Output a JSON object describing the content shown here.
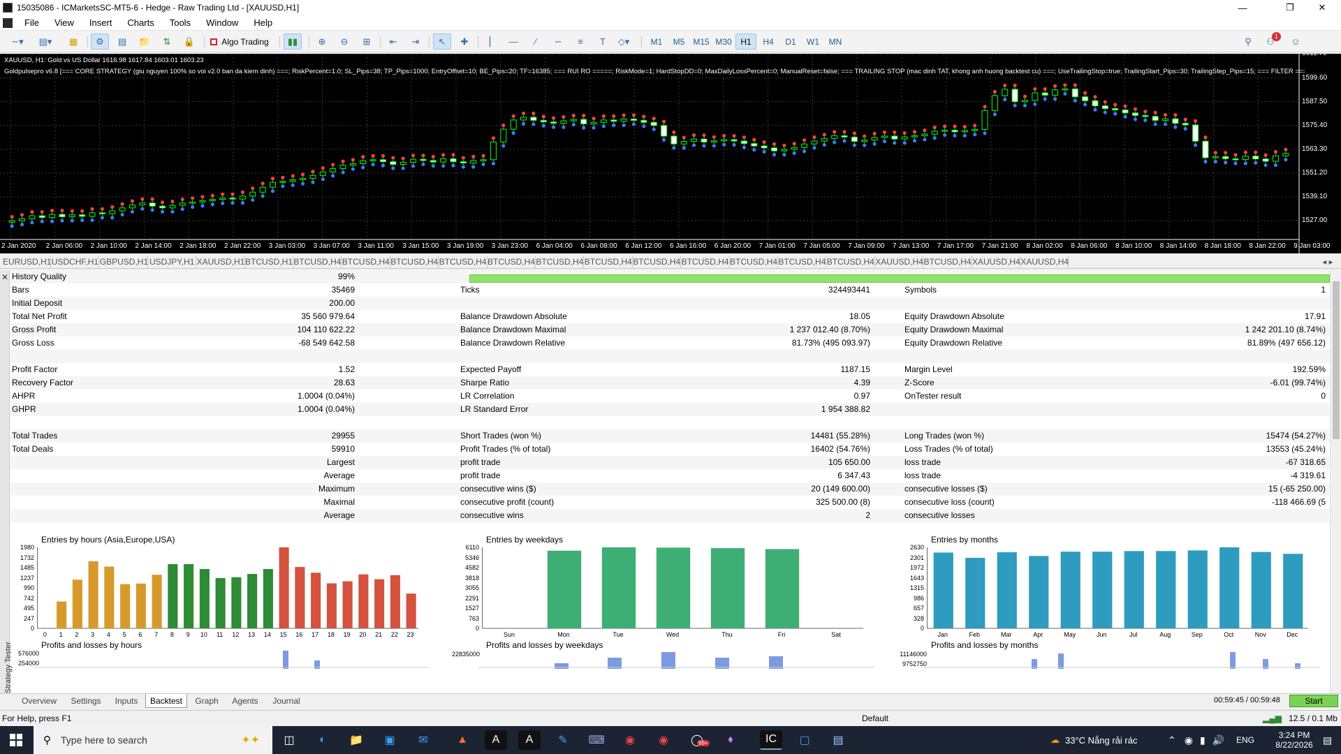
{
  "window": {
    "title": "15035086 - ICMarketsSC-MT5-6 - Hedge - Raw Trading Ltd - [XAUUSD,H1]"
  },
  "menu": [
    "File",
    "View",
    "Insert",
    "Charts",
    "Tools",
    "Window",
    "Help"
  ],
  "toolbar": {
    "algo_label": "Algo Trading",
    "timeframes": [
      "M1",
      "M5",
      "M15",
      "M30",
      "H1",
      "H4",
      "D1",
      "W1",
      "MN"
    ],
    "active_tf": "H1",
    "notif_count": "1"
  },
  "chart": {
    "symbol_line": "XAUUSD, H1:  Gold vs US Dollar  1616.98 1617.84 1603.01 1603.23",
    "ea_line": "Goldpulsepro v6.8 [=== CORE STRATEGY (giu nguyen 100% so voi v2.0 ban da kiem dinh) ===; RiskPercent=1.0; SL_Pips=38; TP_Pips=1000; EntryOffset=10; BE_Pips=20; TF=16385; === RUI RO =====; RiskMode=1; HardStopDD=0; MaxDailyLossPercent=0; ManualReset=false; === TRAILING STOP (mac dinh TAT, khong anh huong backtest cu) ===; UseTrailingStop=true; TrailingStart_Pips=30; TrailingStep_Pips=15; === FILTER ===",
    "price_labels": [
      "1611.70",
      "1599.60",
      "1587.50",
      "1575.40",
      "1563.30",
      "1551.20",
      "1539.10",
      "1527.00"
    ],
    "time_labels": [
      "2 Jan 2020",
      "2 Jan 06:00",
      "2 Jan 10:00",
      "2 Jan 14:00",
      "2 Jan 18:00",
      "2 Jan 22:00",
      "3 Jan 03:00",
      "3 Jan 07:00",
      "3 Jan 11:00",
      "3 Jan 15:00",
      "3 Jan 19:00",
      "3 Jan 23:00",
      "6 Jan 04:00",
      "6 Jan 08:00",
      "6 Jan 12:00",
      "6 Jan 16:00",
      "6 Jan 20:00",
      "7 Jan 01:00",
      "7 Jan 05:00",
      "7 Jan 09:00",
      "7 Jan 13:00",
      "7 Jan 17:00",
      "7 Jan 21:00",
      "8 Jan 02:00",
      "8 Jan 06:00",
      "8 Jan 10:00",
      "8 Jan 14:00",
      "8 Jan 18:00",
      "8 Jan 22:00",
      "9 Jan 03:00"
    ],
    "closes": [
      1527.0,
      1528.0,
      1529.5,
      1528.6,
      1530.2,
      1529.0,
      1530.0,
      1529.2,
      1531.0,
      1530.5,
      1532.0,
      1533.5,
      1535.0,
      1536.0,
      1534.4,
      1533.5,
      1534.8,
      1535.9,
      1536.5,
      1537.2,
      1537.8,
      1538.5,
      1538.0,
      1539.5,
      1541.5,
      1544.0,
      1546.5,
      1547.0,
      1547.8,
      1548.5,
      1550.0,
      1551.8,
      1553.5,
      1555.2,
      1556.0,
      1557.5,
      1558.0,
      1557.0,
      1555.6,
      1556.7,
      1558.2,
      1557.6,
      1556.8,
      1558.5,
      1557.0,
      1556.3,
      1557.6,
      1558.0,
      1567.0,
      1573.5,
      1578.2,
      1579.6,
      1578.0,
      1577.2,
      1576.5,
      1577.8,
      1578.5,
      1576.2,
      1577.0,
      1578.2,
      1577.5,
      1578.7,
      1578.0,
      1577.0,
      1575.4,
      1570.0,
      1566.0,
      1567.3,
      1568.5,
      1567.0,
      1567.6,
      1568.2,
      1567.5,
      1566.2,
      1565.0,
      1564.0,
      1562.5,
      1563.3,
      1564.2,
      1566.0,
      1567.5,
      1568.8,
      1570.2,
      1569.5,
      1567.3,
      1568.0,
      1569.3,
      1570.0,
      1568.5,
      1569.6,
      1570.2,
      1571.0,
      1572.5,
      1573.0,
      1572.2,
      1572.8,
      1573.4,
      1583.0,
      1590.6,
      1593.8,
      1587.5,
      1588.2,
      1592.0,
      1590.8,
      1593.5,
      1594.0,
      1590.0,
      1588.0,
      1585.4,
      1584.0,
      1583.3,
      1581.8,
      1580.5,
      1580.0,
      1578.0,
      1578.8,
      1576.5,
      1575.7,
      1567.4,
      1559.0,
      1559.6,
      1558.5,
      1558.1,
      1559.8,
      1558.4,
      1557.2,
      1560.0,
      1561.2
    ]
  },
  "symbol_tabs": [
    "EURUSD,H1",
    "USDCHF,H1",
    "GBPUSD,H1",
    "USDJPY,H1",
    "XAUUSD,H1",
    "BTCUSD,H1",
    "BTCUSD,H4",
    "BTCUSD,H4",
    "BTCUSD,H4",
    "BTCUSD,H4",
    "BTCUSD,H4",
    "BTCUSD,H4",
    "BTCUSD,H4",
    "BTCUSD,H4",
    "BTCUSD,H4",
    "BTCUSD,H4",
    "BTCUSD,H4",
    "BTCUSD,H4",
    "XAUUSD,H4",
    "BTCUSD,H4",
    "XAUUSD,H4",
    "XAUUSD,H4"
  ],
  "report": {
    "history_quality": {
      "label": "History Quality",
      "value": "99%",
      "fraction": 0.99
    },
    "rows": [
      [
        "Bars",
        "35469",
        "Ticks",
        "324493441",
        "Symbols",
        "1"
      ],
      [
        "Initial Deposit",
        "200.00",
        "",
        "",
        "",
        ""
      ],
      [
        "Total Net Profit",
        "35 560 979.64",
        "Balance Drawdown Absolute",
        "18.05",
        "Equity Drawdown Absolute",
        "17.91"
      ],
      [
        "Gross Profit",
        "104 110 622.22",
        "Balance Drawdown Maximal",
        "1 237 012.40 (8.70%)",
        "Equity Drawdown Maximal",
        "1 242 201.10 (8.74%)"
      ],
      [
        "Gross Loss",
        "-68 549 642.58",
        "Balance Drawdown Relative",
        "81.73% (495 093.97)",
        "Equity Drawdown Relative",
        "81.89% (497 656.12)"
      ],
      [
        "",
        "",
        "",
        "",
        "",
        ""
      ],
      [
        "Profit Factor",
        "1.52",
        "Expected Payoff",
        "1187.15",
        "Margin Level",
        "192.59%"
      ],
      [
        "Recovery Factor",
        "28.63",
        "Sharpe Ratio",
        "4.39",
        "Z-Score",
        "-6.01 (99.74%)"
      ],
      [
        "AHPR",
        "1.0004 (0.04%)",
        "LR Correlation",
        "0.97",
        "OnTester result",
        "0"
      ],
      [
        "GHPR",
        "1.0004 (0.04%)",
        "LR Standard Error",
        "1 954 388.82",
        "",
        ""
      ],
      [
        "",
        "",
        "",
        "",
        "",
        ""
      ],
      [
        "Total Trades",
        "29955",
        "Short Trades (won %)",
        "14481 (55.28%)",
        "Long Trades (won %)",
        "15474 (54.27%)"
      ],
      [
        "Total Deals",
        "59910",
        "Profit Trades (% of total)",
        "16402 (54.76%)",
        "Loss Trades (% of total)",
        "13553 (45.24%)"
      ],
      [
        "",
        "Largest",
        "profit trade",
        "105 650.00",
        "loss trade",
        "-67 318.65"
      ],
      [
        "",
        "Average",
        "profit trade",
        "6 347.43",
        "loss trade",
        "-4 319.61"
      ],
      [
        "",
        "Maximum",
        "consecutive wins ($)",
        "20 (149 600.00)",
        "consecutive losses ($)",
        "15 (-65 250.00)"
      ],
      [
        "",
        "Maximal",
        "consecutive profit (count)",
        "325 500.00 (8)",
        "consecutive loss (count)",
        "-118 466.69 (5"
      ],
      [
        "",
        "Average",
        "consecutive wins",
        "2",
        "consecutive losses",
        ""
      ]
    ]
  },
  "chart_data": [
    {
      "type": "bar",
      "title": "Entries by hours (Asia,Europe,USA)",
      "categories": [
        "0",
        "1",
        "2",
        "3",
        "4",
        "5",
        "6",
        "7",
        "8",
        "9",
        "10",
        "11",
        "12",
        "13",
        "14",
        "15",
        "16",
        "17",
        "18",
        "19",
        "20",
        "21",
        "22",
        "23"
      ],
      "values": [
        0,
        655,
        1190,
        1640,
        1510,
        1080,
        1095,
        1310,
        1570,
        1570,
        1450,
        1230,
        1250,
        1330,
        1450,
        1980,
        1500,
        1360,
        1100,
        1150,
        1320,
        1200,
        1300,
        850
      ],
      "yticks": [
        "1980",
        "1732",
        "1485",
        "1237",
        "990",
        "742",
        "495",
        "247",
        "0"
      ],
      "ylim": [
        0,
        1980
      ],
      "colors": [
        "#d79a2a",
        "#d79a2a",
        "#d79a2a",
        "#d79a2a",
        "#d79a2a",
        "#d79a2a",
        "#d79a2a",
        "#d79a2a",
        "#2e8b36",
        "#2e8b36",
        "#2e8b36",
        "#2e8b36",
        "#2e8b36",
        "#2e8b36",
        "#2e8b36",
        "#d4523f",
        "#d4523f",
        "#d4523f",
        "#d4523f",
        "#d4523f",
        "#d4523f",
        "#d4523f",
        "#d4523f",
        "#d4523f"
      ]
    },
    {
      "type": "bar",
      "title": "Entries by weekdays",
      "categories": [
        "Sun",
        "Mon",
        "Tue",
        "Wed",
        "Thu",
        "Fri",
        "Sat"
      ],
      "values": [
        0,
        5860,
        6110,
        6090,
        6050,
        5980,
        0
      ],
      "yticks": [
        "6110",
        "5346",
        "4582",
        "3818",
        "3055",
        "2291",
        "1527",
        "763",
        "0"
      ],
      "ylim": [
        0,
        6110
      ],
      "colors": [
        "#3fae74",
        "#3fae74",
        "#3fae74",
        "#3fae74",
        "#3fae74",
        "#3fae74",
        "#3fae74"
      ]
    },
    {
      "type": "bar",
      "title": "Entries by months",
      "categories": [
        "Jan",
        "Feb",
        "Mar",
        "Apr",
        "May",
        "Jun",
        "Jul",
        "Aug",
        "Sep",
        "Oct",
        "Nov",
        "Dec"
      ],
      "values": [
        2460,
        2290,
        2470,
        2350,
        2490,
        2490,
        2510,
        2510,
        2530,
        2630,
        2480,
        2420
      ],
      "yticks": [
        "2630",
        "2301",
        "1972",
        "1643",
        "1315",
        "986",
        "657",
        "328",
        "0"
      ],
      "ylim": [
        0,
        2630
      ],
      "colors": [
        "#2e9cbf",
        "#2e9cbf",
        "#2e9cbf",
        "#2e9cbf",
        "#2e9cbf",
        "#2e9cbf",
        "#2e9cbf",
        "#2e9cbf",
        "#2e9cbf",
        "#2e9cbf",
        "#2e9cbf",
        "#2e9cbf"
      ]
    }
  ],
  "panels2": {
    "hours_title": "Profits and losses by hours",
    "hours_y": [
      "576000",
      "254000"
    ],
    "weekdays_title": "Profits and losses by weekdays",
    "weekdays_y": "22835000",
    "months_title": "Profits and losses by months",
    "months_y": [
      "11146000",
      "9752750"
    ]
  },
  "bottom_tabs": [
    "Overview",
    "Settings",
    "Inputs",
    "Backtest",
    "Graph",
    "Agents",
    "Journal"
  ],
  "active_bottom_tab": "Backtest",
  "tester": {
    "vertical_label": "Strategy Tester",
    "time_info": "00:59:45 / 00:59:48",
    "start": "Start"
  },
  "status": {
    "help": "For Help, press F1",
    "profile": "Default",
    "net": "12.5 / 0.1 Mb"
  },
  "taskbar": {
    "search_placeholder": "Type here to search",
    "weather": "33°C  Nắng rải rác",
    "lang": "ENG",
    "time": "3:24 PM",
    "date": "8/22/2026",
    "badge": "99+"
  }
}
